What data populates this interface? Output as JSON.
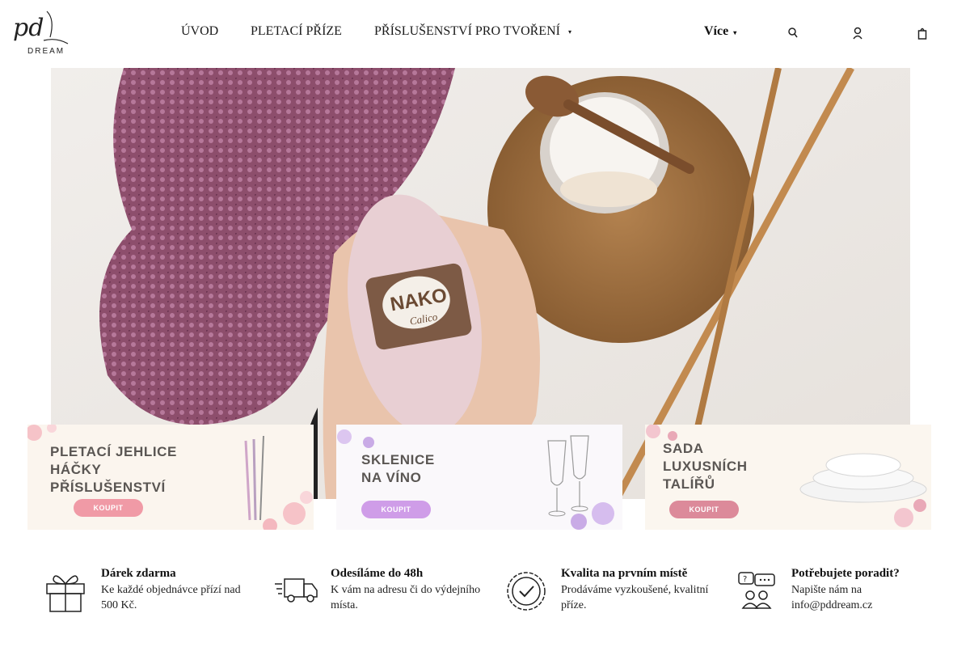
{
  "header": {
    "logo": {
      "text": "pd",
      "subtext": "DREAM"
    },
    "nav": [
      {
        "label": "ÚVOD"
      },
      {
        "label": "PLETACÍ PŘÍZE"
      },
      {
        "label": "PŘÍSLUŠENSTVÍ PRO TVOŘENÍ",
        "has_dropdown": true
      }
    ],
    "more_label": "Více",
    "icons": [
      "search-icon",
      "user-icon",
      "cart-icon"
    ]
  },
  "hero": {
    "yarn_label": "NAKO",
    "yarn_sub": "Calico"
  },
  "banners": [
    {
      "title": "PLETACÍ JEHLICE\nHÁČKY\nPŘÍSLUŠENSTVÍ",
      "button": "KOUPIT",
      "button_color": "#f09aa6"
    },
    {
      "title": "SKLENICE\nNA VÍNO",
      "button": "KOUPIT",
      "button_color": "#cf9de8"
    },
    {
      "title": "SADA\nLUXUSNÍCH\nTALÍŘŮ",
      "button": "KOUPIT",
      "button_color": "#dc8a9a"
    }
  ],
  "features": [
    {
      "icon": "gift-icon",
      "title": "Dárek zdarma",
      "text": "Ke každé objednávce přízí nad 500 Kč."
    },
    {
      "icon": "truck-icon",
      "title": "Odesíláme do 48h",
      "text": "K vám na adresu či do výdejního místa."
    },
    {
      "icon": "quality-badge-icon",
      "title": "Kvalita na prvním místě",
      "text": "Prodáváme vyzkoušené, kvalitní příze."
    },
    {
      "icon": "support-chat-icon",
      "title": "Potřebujete poradit?",
      "text": "Napište nám na info@pddream.cz"
    }
  ]
}
